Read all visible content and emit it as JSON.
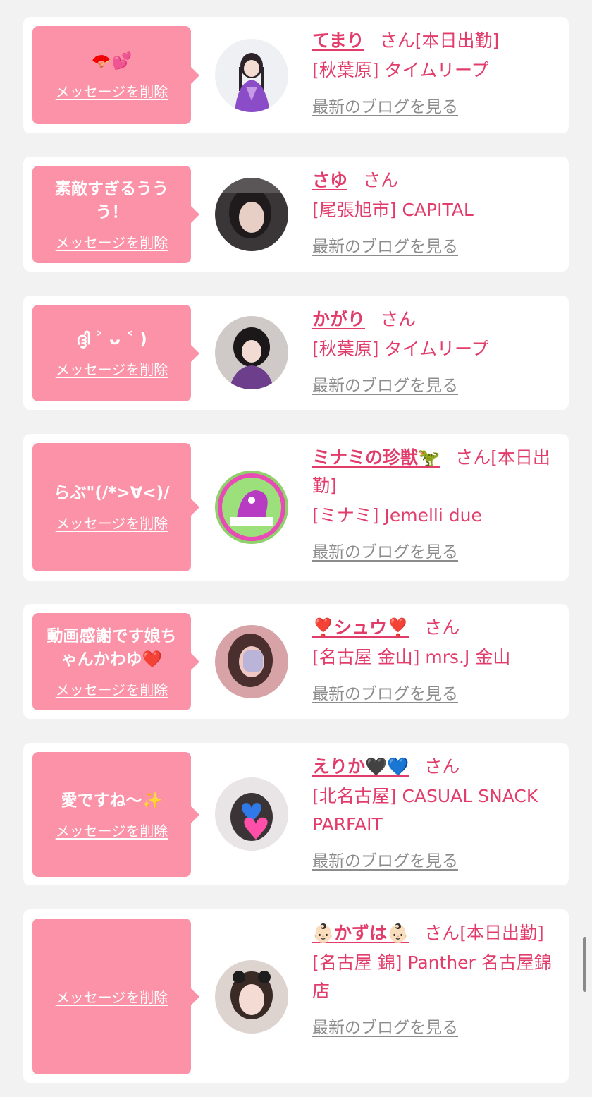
{
  "common": {
    "delete_label": "メッセージを削除",
    "blog_label": "最新のブログを見る"
  },
  "colors": {
    "bubble": "#fb92a7",
    "accent": "#e23c6b",
    "link_gray": "#8c8c8c",
    "background": "#f2f2f2"
  },
  "cards": [
    {
      "message": "🪭💕",
      "name": "てまり",
      "san": "さん[本日出勤]",
      "shop": "[秋葉原] タイムリープ"
    },
    {
      "message": "素敵すぎるううう！",
      "name": "さゆ",
      "san": "さん",
      "shop": "[尾張旭市] CAPITAL"
    },
    {
      "message": "ദ്ദി ˃ ᴗ ˂ )",
      "name": "かがり",
      "san": "さん",
      "shop": "[秋葉原] タイムリープ"
    },
    {
      "message": "らぶ\"(/*>∀<)/",
      "name": "ミナミの珍獣🦖",
      "san": "さん[本日出勤]",
      "shop": "[ミナミ] Jemelli due"
    },
    {
      "message": "動画感謝です娘ちゃんかわゆ❤️",
      "name": "❣️シュウ❣️",
      "san": "さん",
      "shop": "[名古屋 金山] mrs.J 金山"
    },
    {
      "message": "愛ですね〜✨",
      "name": "えりか🖤💙",
      "san": "さん",
      "shop": "[北名古屋] CASUAL SNACK PARFAIT"
    },
    {
      "message": "",
      "name": "👶🏻かずは👶🏻",
      "san": "さん[本日出勤]",
      "shop": "[名古屋 錦] Panther 名古屋錦店"
    }
  ]
}
